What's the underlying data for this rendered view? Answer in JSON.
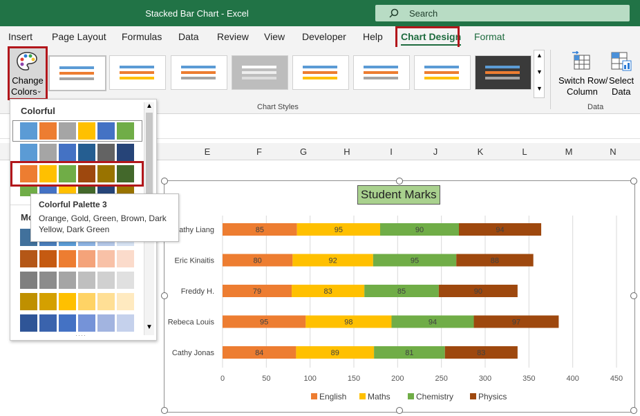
{
  "window": {
    "title": "Stacked Bar Chart  -  Excel",
    "search_label": "Search"
  },
  "tabs": [
    {
      "label": "Insert"
    },
    {
      "label": "Page Layout"
    },
    {
      "label": "Formulas"
    },
    {
      "label": "Data"
    },
    {
      "label": "Review"
    },
    {
      "label": "View"
    },
    {
      "label": "Developer"
    },
    {
      "label": "Help"
    },
    {
      "label": "Chart Design"
    },
    {
      "label": "Format"
    }
  ],
  "ribbon": {
    "change_colors_line1": "Change",
    "change_colors_line2": "Colors",
    "chart_styles_label": "Chart Styles",
    "switch_row_line1": "Switch Row/",
    "switch_row_line2": "Column",
    "select_data_line1": "Select",
    "select_data_line2": "Data",
    "data_group_label": "Data"
  },
  "column_headers": [
    "E",
    "F",
    "G",
    "H",
    "I",
    "J",
    "K",
    "L",
    "M",
    "N"
  ],
  "colors_menu": {
    "colorful_header": "Colorful",
    "monochromatic_header_visible": "Mo",
    "colorful_rows": [
      [
        "#5b9bd5",
        "#ed7d31",
        "#a5a5a5",
        "#ffc000",
        "#4472c4",
        "#70ad47"
      ],
      [
        "#5b9bd5",
        "#a5a5a5",
        "#4472c4",
        "#255e91",
        "#636363",
        "#264478"
      ],
      [
        "#ed7d31",
        "#ffc000",
        "#70ad47",
        "#9e480e",
        "#997300",
        "#43682b"
      ],
      [
        "#70ad47",
        "#4472c4",
        "#ffc000",
        "#43682b",
        "#264478",
        "#997300"
      ]
    ],
    "mono_rows": [
      [
        "#41719c",
        "#4a7ebb",
        "#5b9bd5",
        "#8db3e2",
        "#b4c7e7",
        "#d6e2f2"
      ],
      [
        "#b45717",
        "#c55a11",
        "#ed7d31",
        "#f4a37a",
        "#f8c1a7",
        "#fbdbcb"
      ],
      [
        "#7f7f7f",
        "#8c8c8c",
        "#a5a5a5",
        "#bfbfbf",
        "#d0d0d0",
        "#e0e0e0"
      ],
      [
        "#bf9000",
        "#d4a000",
        "#ffc000",
        "#ffd365",
        "#ffdf95",
        "#ffeac0"
      ],
      [
        "#2f5597",
        "#3a63ad",
        "#4472c4",
        "#7593d8",
        "#a2b4e0",
        "#c5d1ec"
      ]
    ]
  },
  "tooltip": {
    "title": "Colorful Palette 3",
    "line1": "Orange, Gold, Green, Brown, Dark",
    "line2": "Yellow, Dark Green"
  },
  "chart_data": {
    "type": "bar",
    "stacked": true,
    "orientation": "horizontal",
    "title": "Student Marks",
    "categories": [
      "Cathy Liang",
      "Eric Kinaitis",
      "Freddy H.",
      "Rebeca Louis",
      "Cathy Jonas"
    ],
    "series": [
      {
        "name": "English",
        "color": "#ed7d31",
        "values": [
          85,
          80,
          79,
          95,
          84
        ]
      },
      {
        "name": "Maths",
        "color": "#ffc000",
        "values": [
          95,
          92,
          83,
          98,
          89
        ]
      },
      {
        "name": "Chemistry",
        "color": "#70ad47",
        "values": [
          90,
          95,
          85,
          94,
          81
        ]
      },
      {
        "name": "Physics",
        "color": "#9e480e",
        "values": [
          94,
          88,
          90,
          97,
          83
        ]
      }
    ],
    "xlim": [
      0,
      450
    ],
    "xticks": [
      0,
      50,
      100,
      150,
      200,
      250,
      300,
      350,
      400,
      450
    ],
    "grid": true,
    "legend": "bottom"
  }
}
